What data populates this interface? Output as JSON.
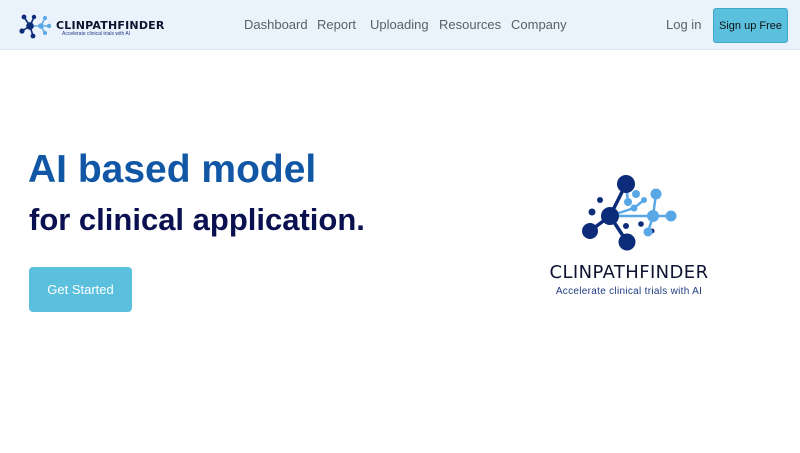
{
  "brand": {
    "name": "CLINPATHFINDER",
    "tagline": "Accelerate clinical trials with AI"
  },
  "nav": {
    "links": [
      "Dashboard",
      "Report",
      "Uploading",
      "Resources",
      "Company"
    ],
    "login": "Log in",
    "signup": "Sign up Free"
  },
  "hero": {
    "title": "AI based model",
    "subtitle": "for clinical application.",
    "cta": "Get Started"
  },
  "colors": {
    "navbar_bg": "#eaf3fb",
    "accent": "#5bc0de",
    "title_blue": "#1157a6",
    "navy": "#0b1150",
    "logo_dark": "#0c2b78",
    "logo_light": "#5aa7e6"
  },
  "icons": {
    "brand_logo": "network-nodes-icon",
    "hero_logo": "network-nodes-icon"
  }
}
